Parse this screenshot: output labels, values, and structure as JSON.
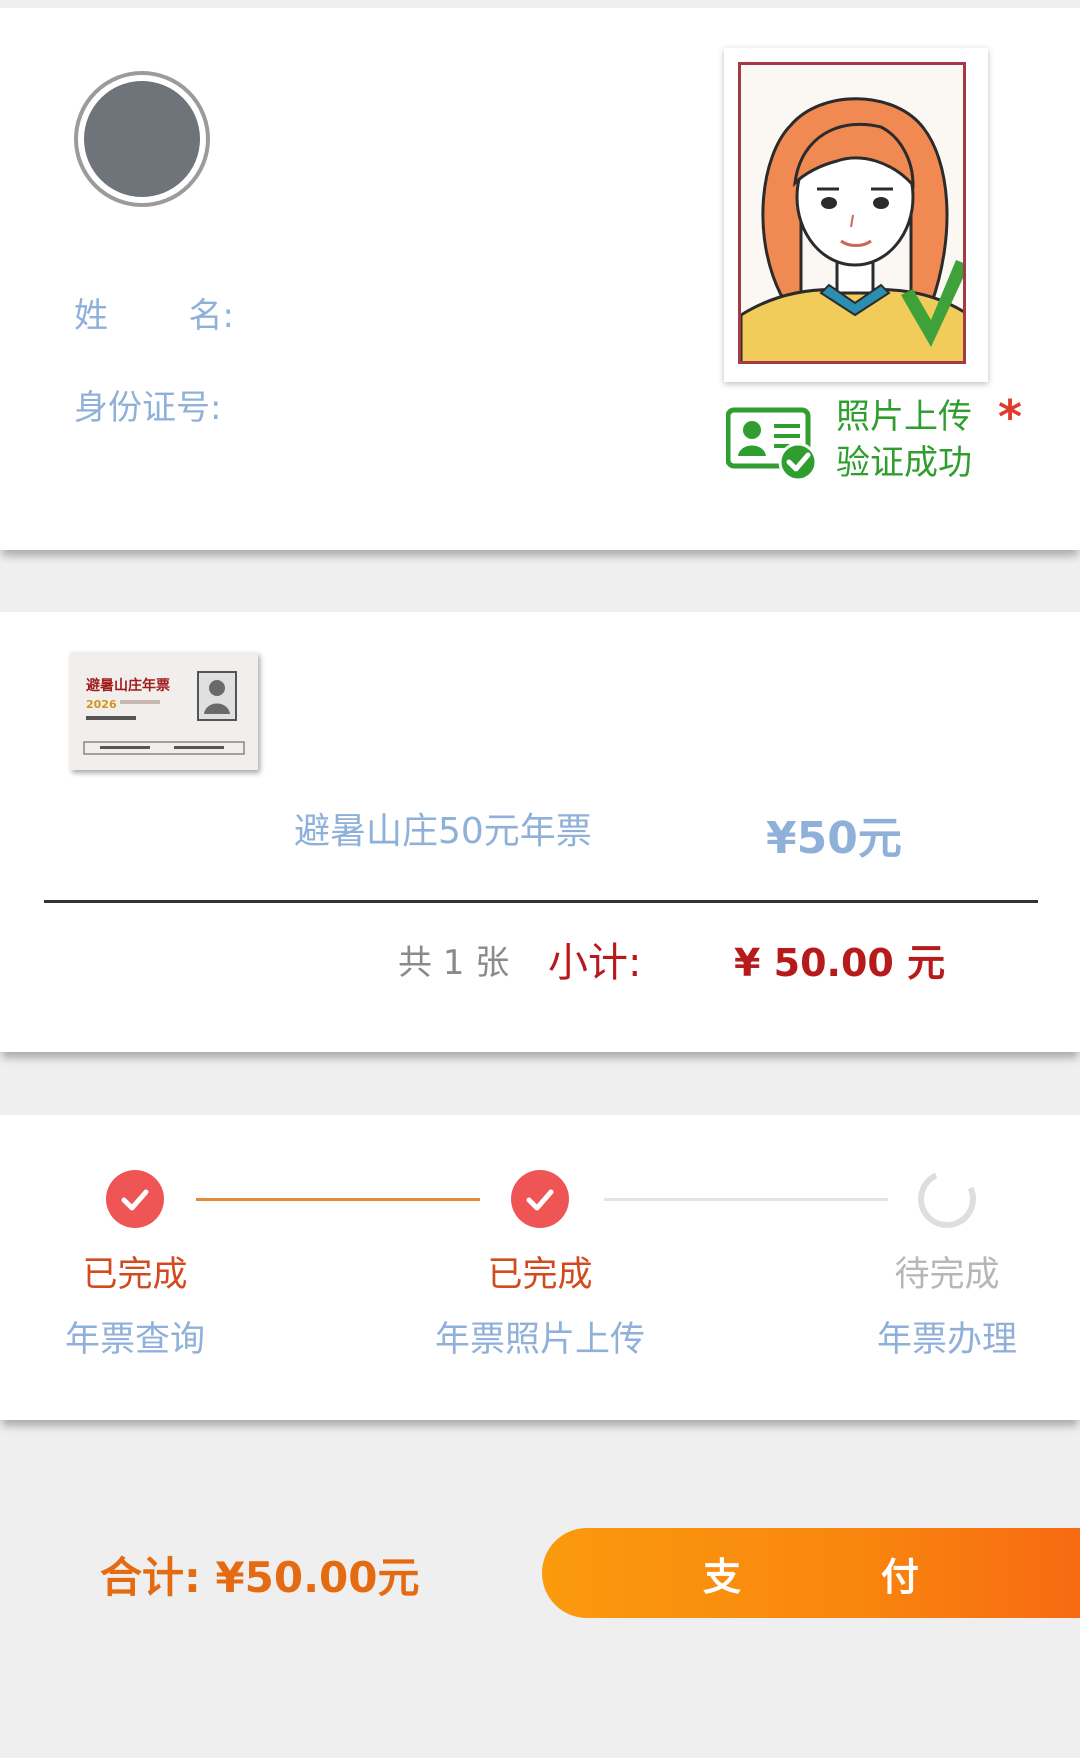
{
  "user": {
    "name_label_chars": [
      "姓",
      "名:"
    ],
    "id_label": "身份证号:",
    "verify_text_line1": "照片上传",
    "verify_text_line2": "验证成功",
    "verify_required": "*"
  },
  "ticket": {
    "thumb_title": "避暑山庄年票",
    "thumb_year": "2026",
    "name": "避暑山庄50元年票",
    "price": "¥50元",
    "count": "共 1 张",
    "subtotal_label": "小计:",
    "subtotal_value": "¥ 50.00 元"
  },
  "steps": [
    {
      "status": "已完成",
      "name": "年票查询",
      "done": true
    },
    {
      "status": "已完成",
      "name": "年票照片上传",
      "done": true
    },
    {
      "status": "待完成",
      "name": "年票办理",
      "done": false
    }
  ],
  "footer": {
    "total": "合计: ¥50.00元",
    "pay_label": "支付"
  },
  "colors": {
    "accent_orange": "#f9850e",
    "success_green": "#2f9e2f",
    "label_blue": "#8fb1d9",
    "price_red": "#b61a1a"
  }
}
